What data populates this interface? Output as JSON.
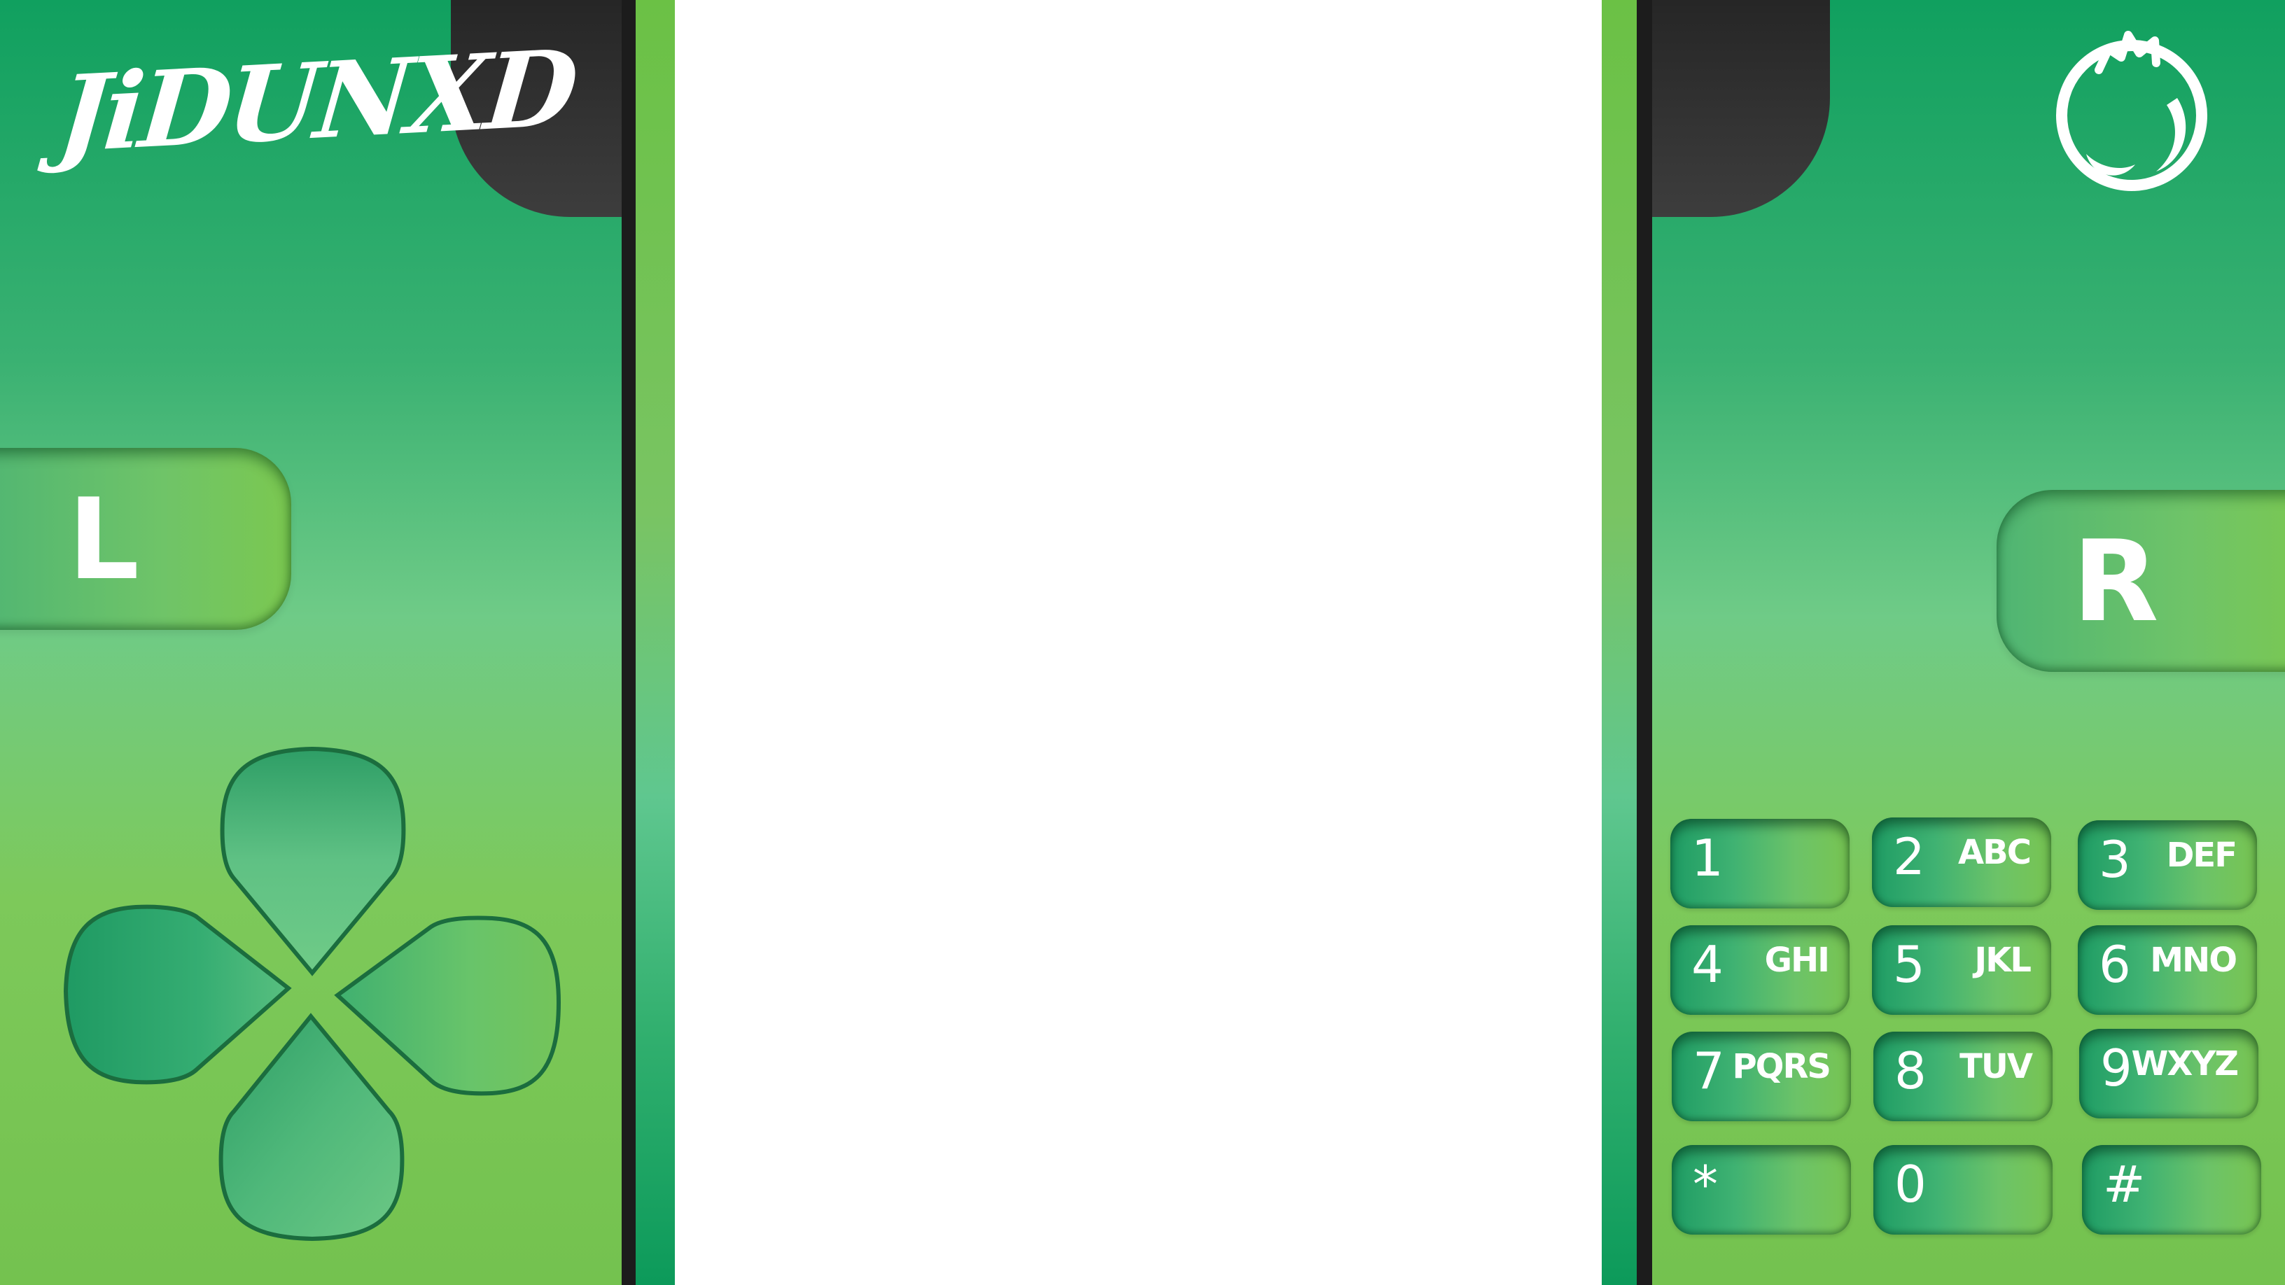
{
  "brand": {
    "logo_text": "JiDUNXD"
  },
  "icons": {
    "emblem": "dragon-ring-icon",
    "dpad": "dpad-icon"
  },
  "shoulder_buttons": {
    "left_label": "L",
    "right_label": "R"
  },
  "keypad": [
    {
      "digit": "1",
      "letters": ""
    },
    {
      "digit": "2",
      "letters": "ABC"
    },
    {
      "digit": "3",
      "letters": "DEF"
    },
    {
      "digit": "4",
      "letters": "GHI"
    },
    {
      "digit": "5",
      "letters": "JKL"
    },
    {
      "digit": "6",
      "letters": "MNO"
    },
    {
      "digit": "7",
      "letters": "PQRS"
    },
    {
      "digit": "8",
      "letters": "TUV"
    },
    {
      "digit": "9",
      "letters": "WXYZ"
    },
    {
      "digit": "*",
      "letters": ""
    },
    {
      "digit": "0",
      "letters": ""
    },
    {
      "digit": "#",
      "letters": ""
    }
  ],
  "colors": {
    "panel_green": "#3ab172",
    "accent_lime": "#74c24f",
    "notch_dark": "#2e2e2e",
    "screen_white": "#ffffff"
  }
}
